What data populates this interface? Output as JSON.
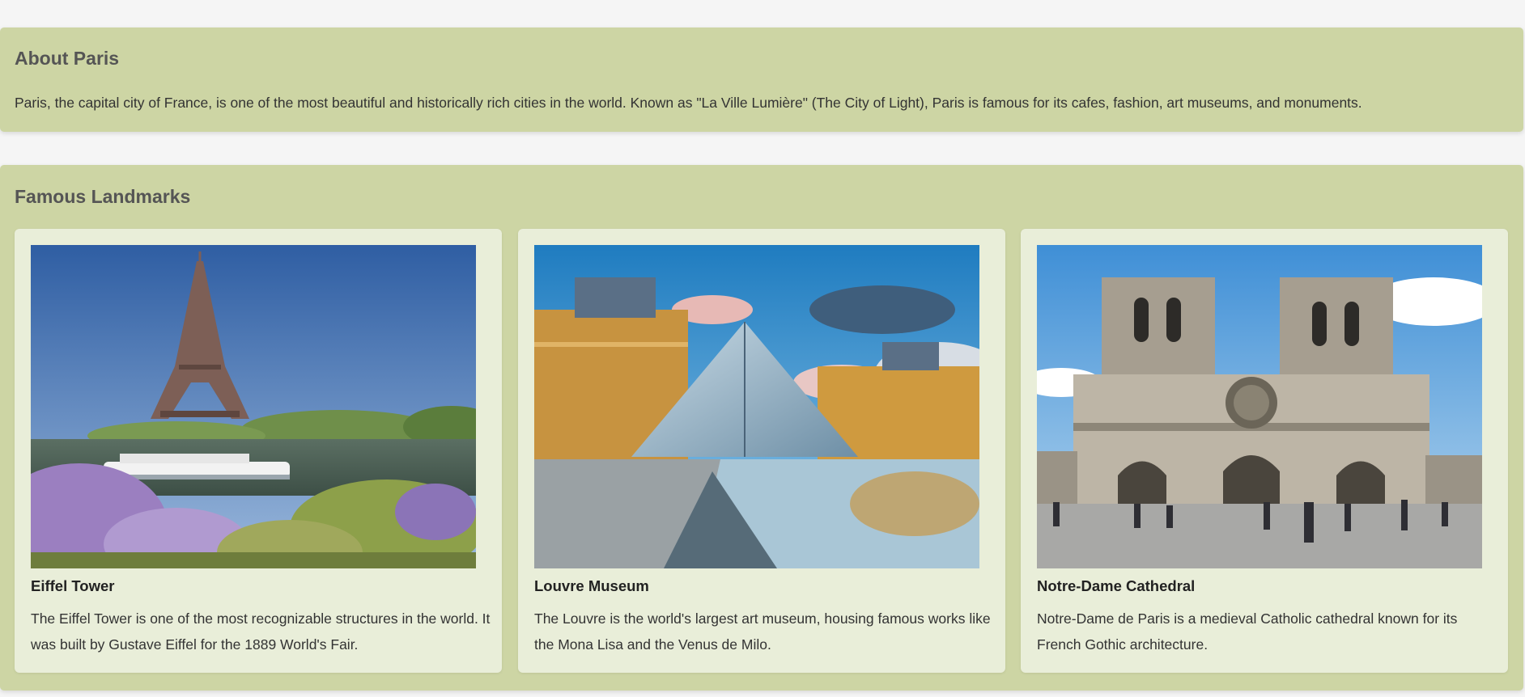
{
  "about": {
    "title": "About Paris",
    "text": "Paris, the capital city of France, is one of the most beautiful and historically rich cities in the world. Known as \"La Ville Lumière\" (The City of Light), Paris is famous for its cafes, fashion, art museums, and monuments."
  },
  "landmarks": {
    "title": "Famous Landmarks",
    "cards": [
      {
        "name": "Eiffel Tower",
        "text": "The Eiffel Tower is one of the most recognizable structures in the world. It was built by Gustave Eiffel for the 1889 World's Fair."
      },
      {
        "name": "Louvre Museum",
        "text": "The Louvre is the world's largest art museum, housing famous works like the Mona Lisa and the Venus de Milo."
      },
      {
        "name": "Notre-Dame Cathedral",
        "text": "Notre-Dame de Paris is a medieval Catholic cathedral known for its French Gothic architecture."
      }
    ]
  },
  "colors": {
    "section_bg": "#cdd5a4",
    "card_bg": "#e9eed9",
    "page_bg": "#f5f5f5",
    "heading": "#555555"
  }
}
